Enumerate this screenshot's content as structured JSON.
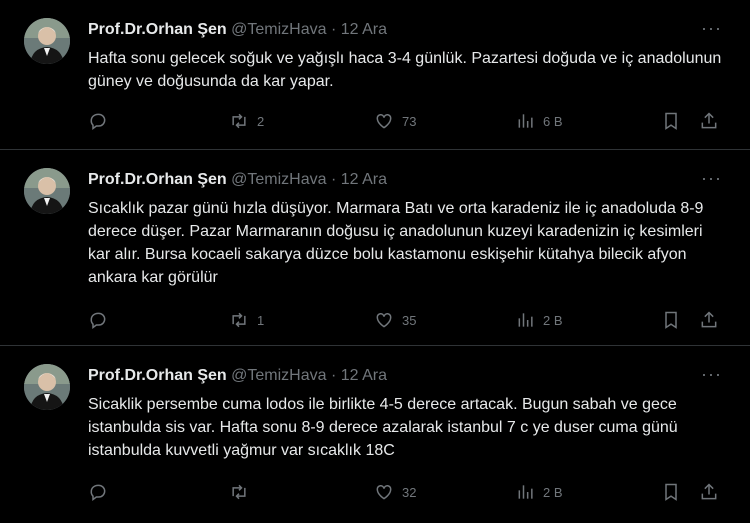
{
  "colors": {
    "background": "#000000",
    "text": "#e7e9ea",
    "muted": "#71767b",
    "divider": "#2f3336"
  },
  "tweets": [
    {
      "name": "Prof.Dr.Orhan Şen",
      "handle": "@TemizHava",
      "sep": "·",
      "date": "12 Ara",
      "more": "···",
      "text": "Hafta sonu gelecek soğuk ve yağışlı haca 3-4 günlük. Pazartesi doğuda ve iç anadolunun güney ve doğusunda da kar yapar.",
      "replies": "",
      "retweets": "2",
      "likes": "73",
      "views": "6 B"
    },
    {
      "name": "Prof.Dr.Orhan Şen",
      "handle": "@TemizHava",
      "sep": "·",
      "date": "12 Ara",
      "more": "···",
      "text": "Sıcaklık pazar günü hızla düşüyor. Marmara Batı ve orta karadeniz ile iç anadoluda 8-9 derece düşer. Pazar Marmaranın doğusu iç anadolunun kuzeyi karadenizin iç kesimleri kar alır. Bursa kocaeli sakarya düzce bolu kastamonu eskişehir kütahya bilecik afyon ankara kar görülür",
      "replies": "",
      "retweets": "1",
      "likes": "35",
      "views": "2 B"
    },
    {
      "name": "Prof.Dr.Orhan Şen",
      "handle": "@TemizHava",
      "sep": "·",
      "date": "12 Ara",
      "more": "···",
      "text": "Sicaklik persembe cuma lodos ile birlikte 4-5 derece artacak.  Bugun sabah ve gece istanbulda sis var. Hafta sonu 8-9 derece azalarak istanbul 7 c ye duser cuma günü istanbulda kuvvetli yağmur var sıcaklık 18C",
      "replies": "",
      "retweets": "",
      "likes": "32",
      "views": "2 B"
    }
  ]
}
